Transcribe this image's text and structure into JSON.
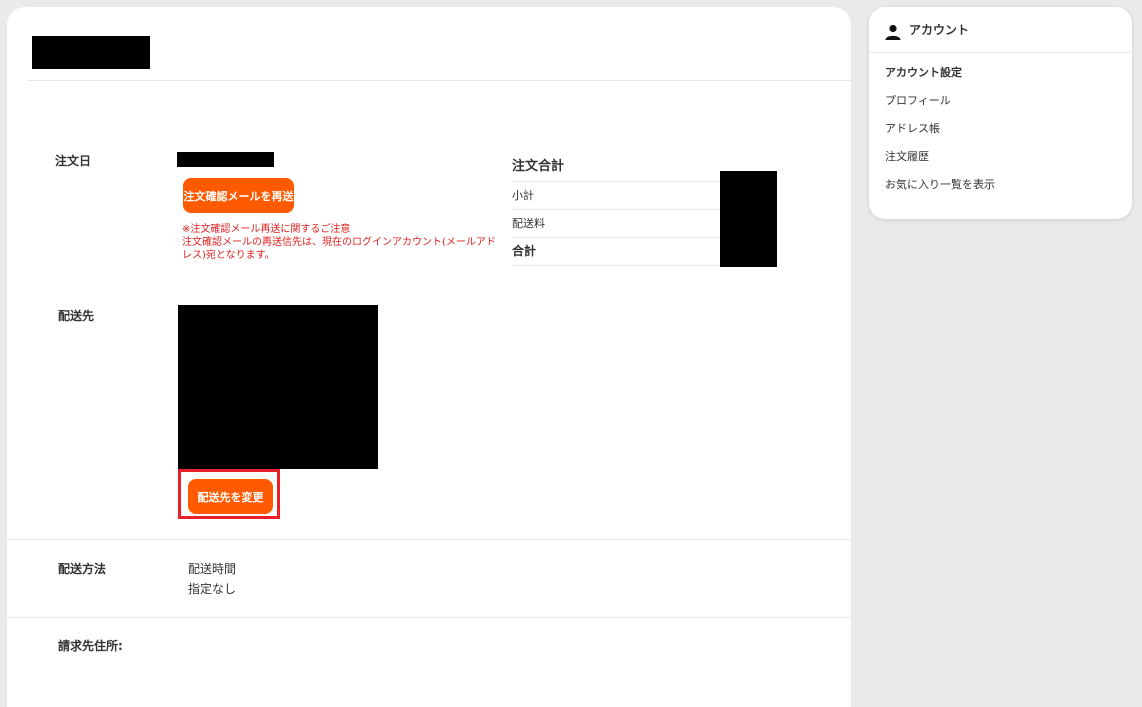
{
  "order": {
    "date_label": "注文日",
    "resend_button": "注文確認メールを再送",
    "notice_line1": "※注文確認メール再送に関するご注意",
    "notice_line2": "注文確認メールの再送信先は、現在のログインアカウント(メールアドレス)宛となります。"
  },
  "totals": {
    "title": "注文合計",
    "subtotal_label": "小計",
    "shipping_label": "配送料",
    "total_label": "合計"
  },
  "shipping_address": {
    "label": "配送先",
    "change_button": "配送先を変更"
  },
  "shipping_method": {
    "label": "配送方法",
    "time_label": "配送時間",
    "time_value": "指定なし"
  },
  "billing": {
    "label": "請求先住所:"
  },
  "sidebar": {
    "title": "アカウント",
    "icon": "person-icon",
    "section_title": "アカウント設定",
    "links": [
      "プロフィール",
      "アドレス帳",
      "注文履歴",
      "お気に入り一覧を表示"
    ]
  },
  "colors": {
    "accent": "#ff5a00",
    "notice": "#e02020",
    "highlight": "#e8202a"
  }
}
